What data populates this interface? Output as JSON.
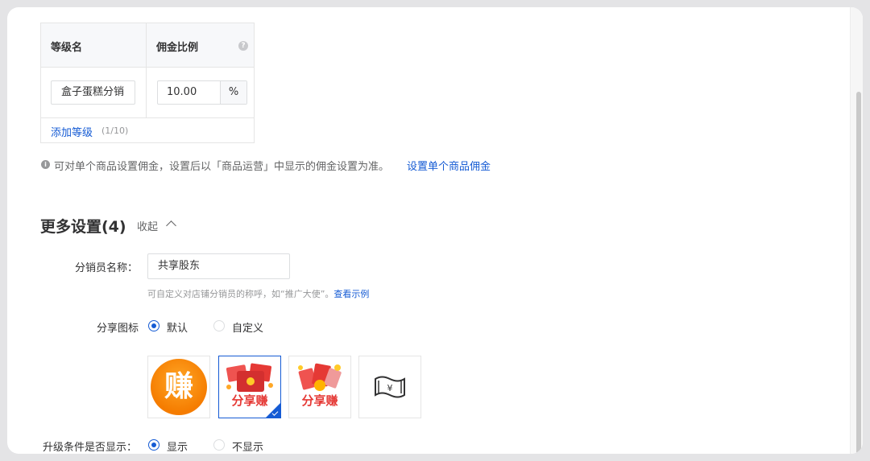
{
  "level_table": {
    "header_name": "等级名",
    "header_ratio": "佣金比例",
    "help_icon": "question-circle-icon",
    "rows": [
      {
        "name": "盒子蛋糕分销",
        "ratio": "10.00",
        "unit": "%"
      }
    ],
    "add_level": "添加等级",
    "add_level_count": "(1/10)"
  },
  "tip": {
    "icon": "info-circle-icon",
    "text": "可对单个商品设置佣金，设置后以「商品运营」中显示的佣金设置为准。",
    "link": "设置单个商品佣金"
  },
  "more_settings": {
    "title": "更多设置(4)",
    "collapse_label": "收起",
    "collapse_icon": "chevron-up-icon",
    "distributor_name": {
      "label": "分销员名称：",
      "value": "共享股东",
      "hint": "可自定义对店铺分销员的称呼，如“推广大使”。",
      "hint_link": "查看示例"
    },
    "share_icon": {
      "label": "分享图标",
      "options": [
        {
          "label": "默认",
          "selected": true
        },
        {
          "label": "自定义",
          "selected": false
        }
      ],
      "icons": [
        {
          "name": "earn-icon",
          "text": "赚",
          "selected": false
        },
        {
          "name": "red-envelope-share-earn-icon",
          "text": "分享赚",
          "selected": true
        },
        {
          "name": "red-envelope-coins-share-earn-icon",
          "text": "分享赚",
          "selected": false
        },
        {
          "name": "yuan-banknote-icon",
          "text": "",
          "selected": false
        }
      ]
    },
    "upgrade_display": {
      "label": "升级条件是否显示：",
      "options": [
        {
          "label": "显示",
          "selected": true
        },
        {
          "label": "不显示",
          "selected": false
        }
      ]
    }
  },
  "colors": {
    "primary": "#155bd4",
    "text": "#323233",
    "muted": "#969799",
    "border": "#e5e5e5"
  }
}
